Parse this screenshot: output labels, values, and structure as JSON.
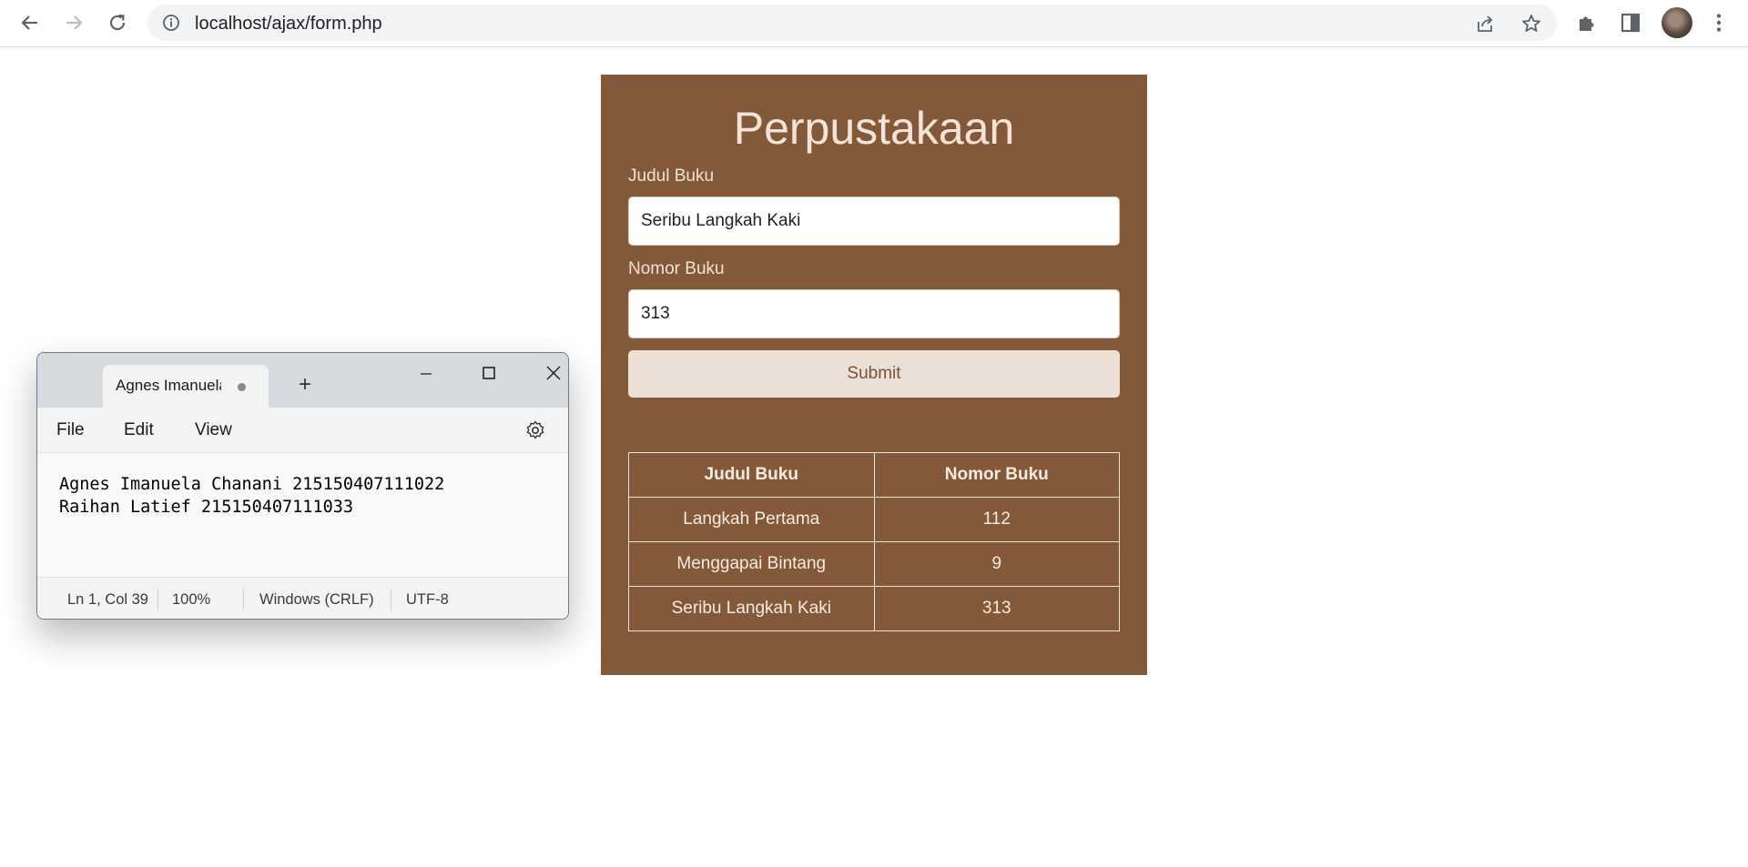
{
  "browser": {
    "url": "localhost/ajax/form.php"
  },
  "library": {
    "title": "Perpustakaan",
    "fields": {
      "title_label": "Judul Buku",
      "title_value": "Seribu Langkah Kaki",
      "number_label": "Nomor Buku",
      "number_value": "313"
    },
    "submit_label": "Submit",
    "table": {
      "headers": [
        "Judul Buku",
        "Nomor Buku"
      ],
      "rows": [
        [
          "Langkah Pertama",
          "112"
        ],
        [
          "Menggapai Bintang",
          "9"
        ],
        [
          "Seribu Langkah Kaki",
          "313"
        ]
      ]
    },
    "colors": {
      "card_background": "#84593a",
      "submit_background": "#ebdfd6"
    }
  },
  "notepad": {
    "tab_title": "Agnes Imanuela Chanani",
    "new_tab_symbol": "+",
    "menu": [
      "File",
      "Edit",
      "View"
    ],
    "lines": [
      "Agnes Imanuela Chanani 215150407111022",
      "Raihan Latief 215150407111033"
    ],
    "status": {
      "position": "Ln 1, Col 39",
      "zoom": "100%",
      "line_ending": "Windows (CRLF)",
      "encoding": "UTF-8"
    }
  }
}
